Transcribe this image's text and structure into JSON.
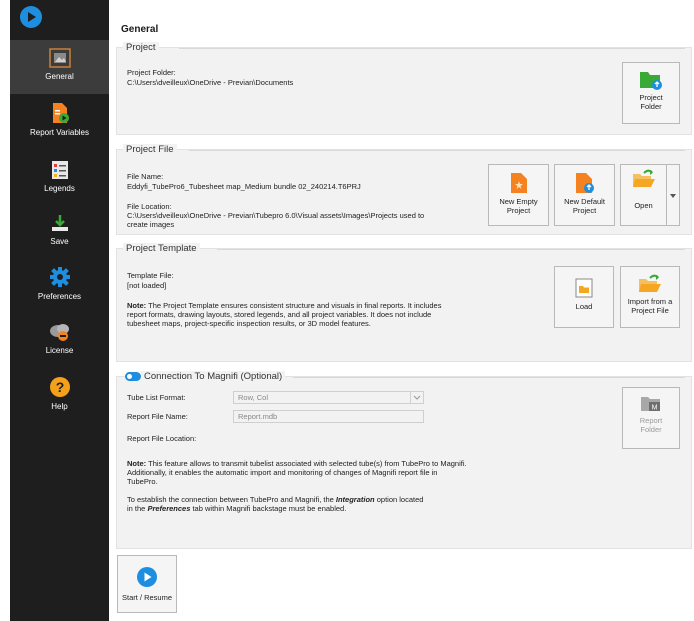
{
  "sidebar": {
    "items": [
      {
        "label": "General"
      },
      {
        "label": "Report Variables"
      },
      {
        "label": "Legends"
      },
      {
        "label": "Save"
      },
      {
        "label": "Preferences"
      },
      {
        "label": "License"
      },
      {
        "label": "Help"
      }
    ]
  },
  "main": {
    "title": "General",
    "project": {
      "heading": "Project",
      "folder_label": "Project Folder:",
      "folder_value": "C:\\Users\\dveilleux\\OneDrive - Previan\\Documents",
      "folder_button": [
        "Project",
        "Folder"
      ]
    },
    "project_file": {
      "heading": "Project File",
      "name_label": "File Name:",
      "name_value": "Eddyfi_TubePro6_Tubesheet map_Medium bundle 02_240214.T6PRJ",
      "location_label": "File Location:",
      "location_value_1": "C:\\Users\\dveilleux\\OneDrive - Previan\\Tubepro 6.0\\Visual assets\\Images\\Projects used to",
      "location_value_2": "create images",
      "new_empty": [
        "New Empty",
        "Project"
      ],
      "new_default": [
        "New Default",
        "Project"
      ],
      "open": "Open"
    },
    "project_template": {
      "heading": "Project Template",
      "file_label": "Template File:",
      "file_value": "[not loaded]",
      "note_bold": "Note:",
      "note_1": " The Project Template ensures consistent structure and visuals in final reports. It includes",
      "note_2": "report formats, drawing layouts, stored legends, and all project variables. It does not include",
      "note_3": "tubesheet maps, project-specific inspection results, or 3D model features.",
      "load": "Load",
      "import": [
        "Import from a",
        "Project File"
      ]
    },
    "magnifi": {
      "heading": "Connection To Magnifi (Optional)",
      "tube_list_label": "Tube List Format:",
      "tube_list_value": "Row, Col",
      "report_name_label": "Report File Name:",
      "report_name_value": "Report.mdb",
      "report_location_label": "Report File Location:",
      "report_folder": [
        "Report",
        "Folder"
      ],
      "note_bold": "Note:",
      "note_1": " This feature allows to transmit tubelist associated with selected tube(s) from TubePro to Magnifi.",
      "note_2": "Additionally, it enables the automatic import and monitoring of changes of Magnifi report file in",
      "note_3": "TubePro.",
      "conn_1a": "To establish the connection between TubePro and Magnifi, the ",
      "conn_1b": "Integration",
      "conn_1c": " option located",
      "conn_2a": " in the ",
      "conn_2b": "Preferences",
      "conn_2c": " tab within Magnifi backstage must be enabled."
    },
    "start_button": "Start / Resume"
  },
  "colors": {
    "sidebar_bg": "#1e1e1e",
    "accent_blue": "#1e8fe0",
    "accent_orange": "#f58220",
    "accent_green": "#3aa935",
    "panel_bg": "#f2f2f2"
  }
}
